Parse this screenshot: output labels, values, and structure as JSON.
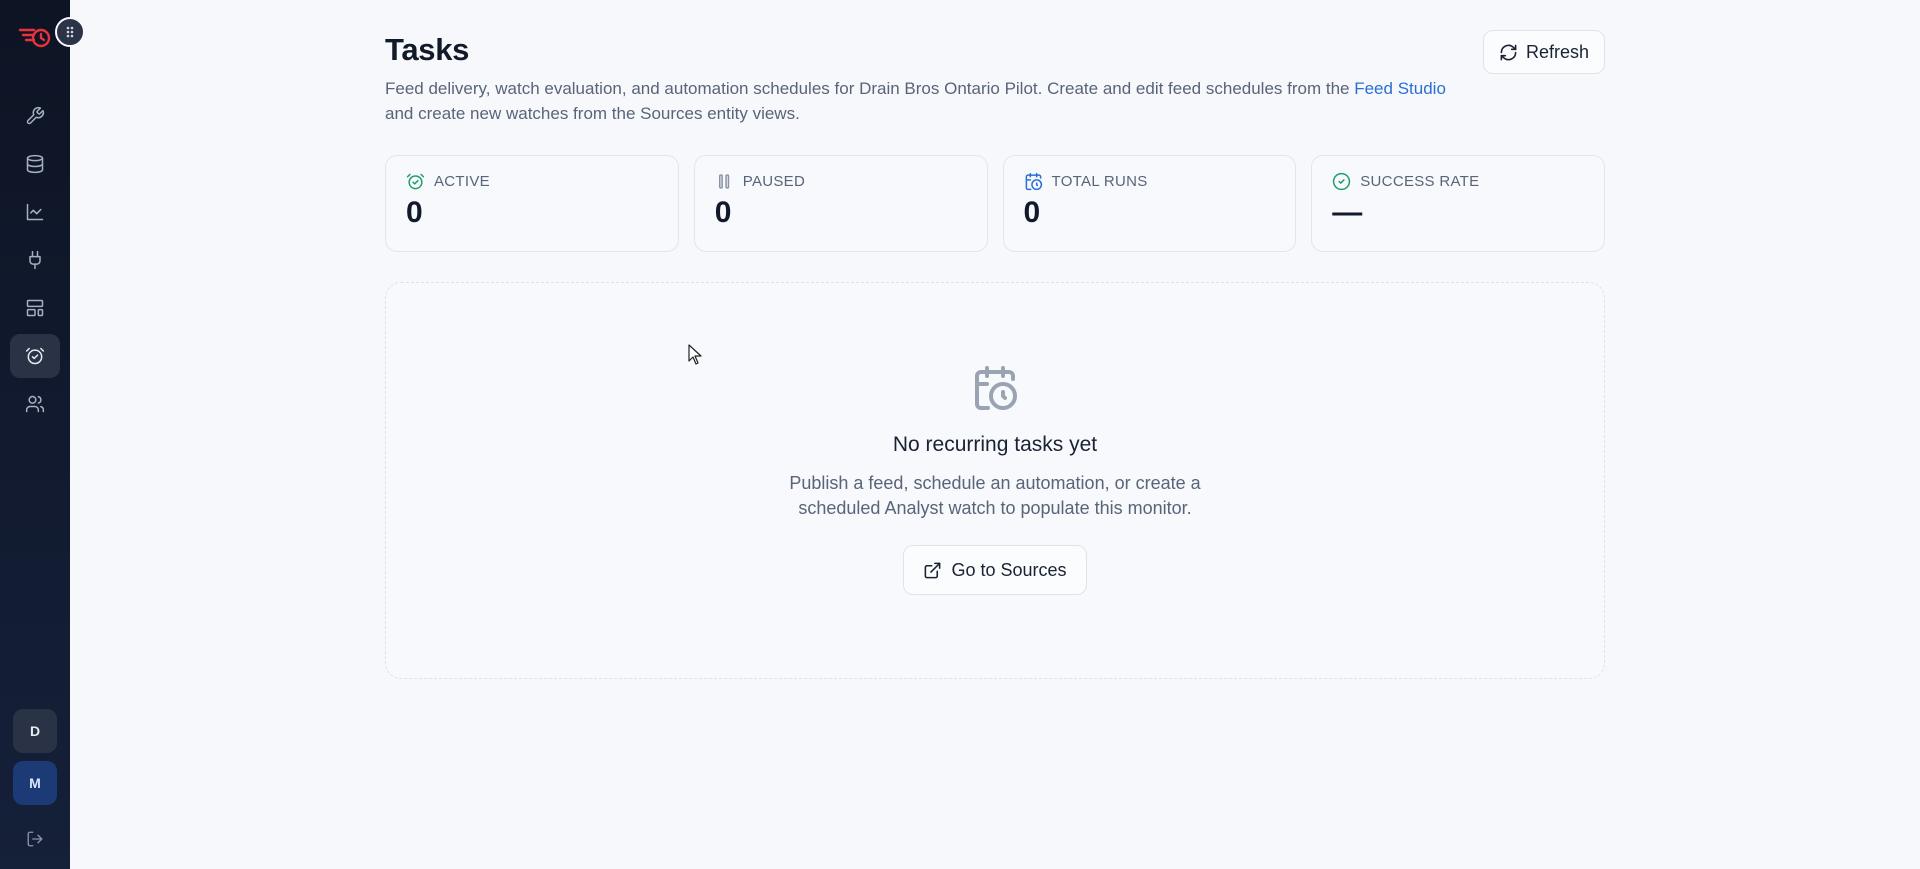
{
  "sidebar": {
    "logo": "brand-logo",
    "nav": [
      {
        "name": "tools",
        "icon": "wrench-icon",
        "active": false
      },
      {
        "name": "data",
        "icon": "database-icon",
        "active": false
      },
      {
        "name": "analytics",
        "icon": "chart-line-icon",
        "active": false
      },
      {
        "name": "integrations",
        "icon": "plug-icon",
        "active": false
      },
      {
        "name": "layouts",
        "icon": "layout-icon",
        "active": false
      },
      {
        "name": "tasks",
        "icon": "alarm-check-icon",
        "active": true
      },
      {
        "name": "users",
        "icon": "users-icon",
        "active": false
      }
    ],
    "avatars": {
      "d": "D",
      "m": "M"
    }
  },
  "header": {
    "title": "Tasks",
    "refresh_label": "Refresh",
    "description_before": "Feed delivery, watch evaluation, and automation schedules for Drain Bros Ontario Pilot. Create and edit feed schedules from the ",
    "description_link": "Feed Studio",
    "description_after": " and create new watches from the Sources entity views."
  },
  "stats": [
    {
      "label": "ACTIVE",
      "value": "0",
      "icon": "alarm-check-icon",
      "color": "#1f9d6b"
    },
    {
      "label": "PAUSED",
      "value": "0",
      "icon": "pause-icon",
      "color": "#8a93a5"
    },
    {
      "label": "TOTAL RUNS",
      "value": "0",
      "icon": "calendar-clock-icon",
      "color": "#2a6fd6"
    },
    {
      "label": "SUCCESS RATE",
      "value": "—",
      "icon": "check-circle-icon",
      "color": "#1f9d6b"
    }
  ],
  "empty_state": {
    "icon": "calendar-clock-icon",
    "title": "No recurring tasks yet",
    "text": "Publish a feed, schedule an automation, or create a scheduled Analyst watch to populate this monitor.",
    "button_label": "Go to Sources"
  }
}
